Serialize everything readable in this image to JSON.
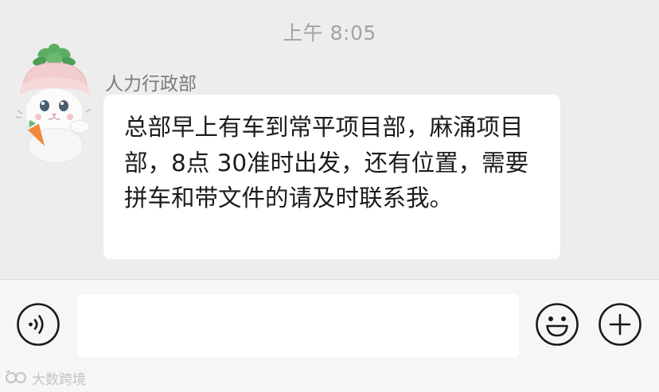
{
  "chat": {
    "timestamp": "上午 8:05",
    "messages": [
      {
        "sender": "人力行政部",
        "avatar_icon": "cat-avatar-icon",
        "text": "总部早上有车到常平项目部，麻涌项目部，8点 30准时出发，还有位置，需要拼车和带文件的请及时联系我。"
      }
    ]
  },
  "input_bar": {
    "value": "",
    "voice_icon": "voice-icon",
    "emoji_icon": "emoji-icon",
    "plus_icon": "plus-icon"
  },
  "watermark": {
    "text": "大数跨境"
  },
  "colors": {
    "chat_background": "#ededed",
    "bubble": "#ffffff",
    "input_bar": "#f6f6f6",
    "icon_stroke": "#191919"
  }
}
